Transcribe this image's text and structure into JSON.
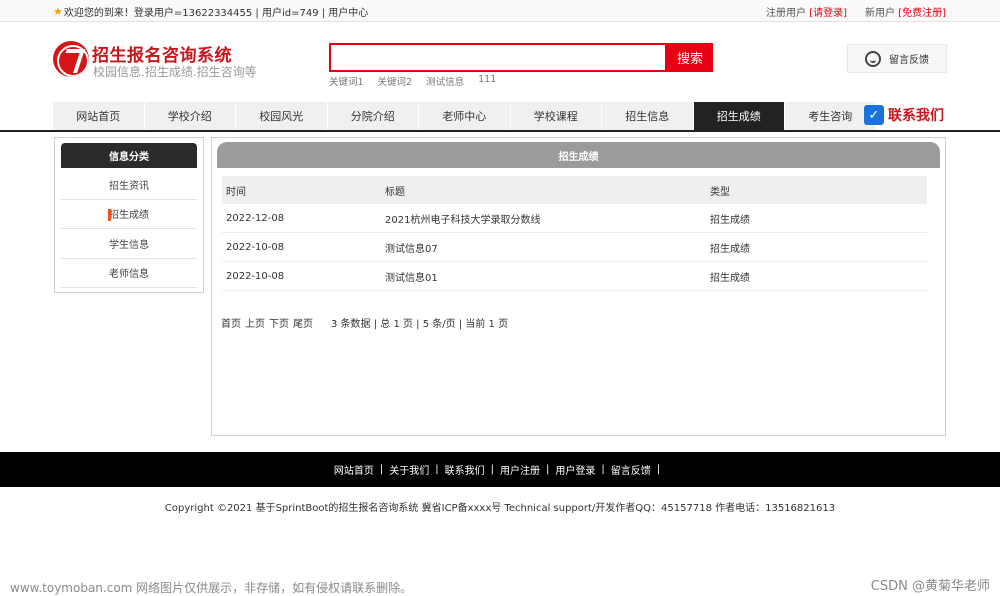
{
  "topbar": {
    "welcome": "欢迎您的到来！登录用户=13622334455 | 用户id=749 | 用户中心",
    "register_prefix": "注册用户",
    "register_link": "[请登录]",
    "new_user_prefix": "新用户",
    "new_user_link": "[免费注册]"
  },
  "header": {
    "title": "招生报名咨询系统",
    "subtitle": "校园信息.招生成绩.招生咨询等",
    "search_value": "",
    "search_button": "搜索",
    "keywords": [
      "关键词1",
      "关键词2",
      "测试信息",
      "111"
    ],
    "feedback": "留言反馈"
  },
  "nav": {
    "items": [
      "网站首页",
      "学校介绍",
      "校园风光",
      "分院介绍",
      "老师中心",
      "学校课程",
      "招生信息",
      "招生成绩",
      "考生咨询"
    ],
    "active_index": 7,
    "contact": "联系我们"
  },
  "sidebar": {
    "title": "信息分类",
    "items": [
      "招生资讯",
      "招生成绩",
      "学生信息",
      "老师信息"
    ],
    "active_index": 1
  },
  "main": {
    "title": "招生成绩",
    "columns": [
      "时间",
      "标题",
      "类型"
    ],
    "rows": [
      {
        "date": "2022-12-08",
        "title": "2021杭州电子科技大学录取分数线",
        "type": "招生成绩"
      },
      {
        "date": "2022-10-08",
        "title": "测试信息07",
        "type": "招生成绩"
      },
      {
        "date": "2022-10-08",
        "title": "测试信息01",
        "type": "招生成绩"
      }
    ],
    "pager": {
      "first": "首页",
      "prev": "上页",
      "next": "下页",
      "last": "尾页",
      "info": "3 条数据 | 总 1 页 | 5 条/页 | 当前 1 页"
    }
  },
  "footer": {
    "links": [
      "网站首页",
      "关于我们",
      "联系我们",
      "用户注册",
      "用户登录",
      "留言反馈"
    ],
    "copyright": "Copyright ©2021 基于SprintBoot的招生报名咨询系统    冀省ICP备xxxx号    Technical support/开发作者QQ：45157718    作者电话：13516821613"
  },
  "watermarks": {
    "left": "www.toymoban.com 网络图片仅供展示，非存储，如有侵权请联系删除。",
    "right": "CSDN @黄菊华老师"
  }
}
